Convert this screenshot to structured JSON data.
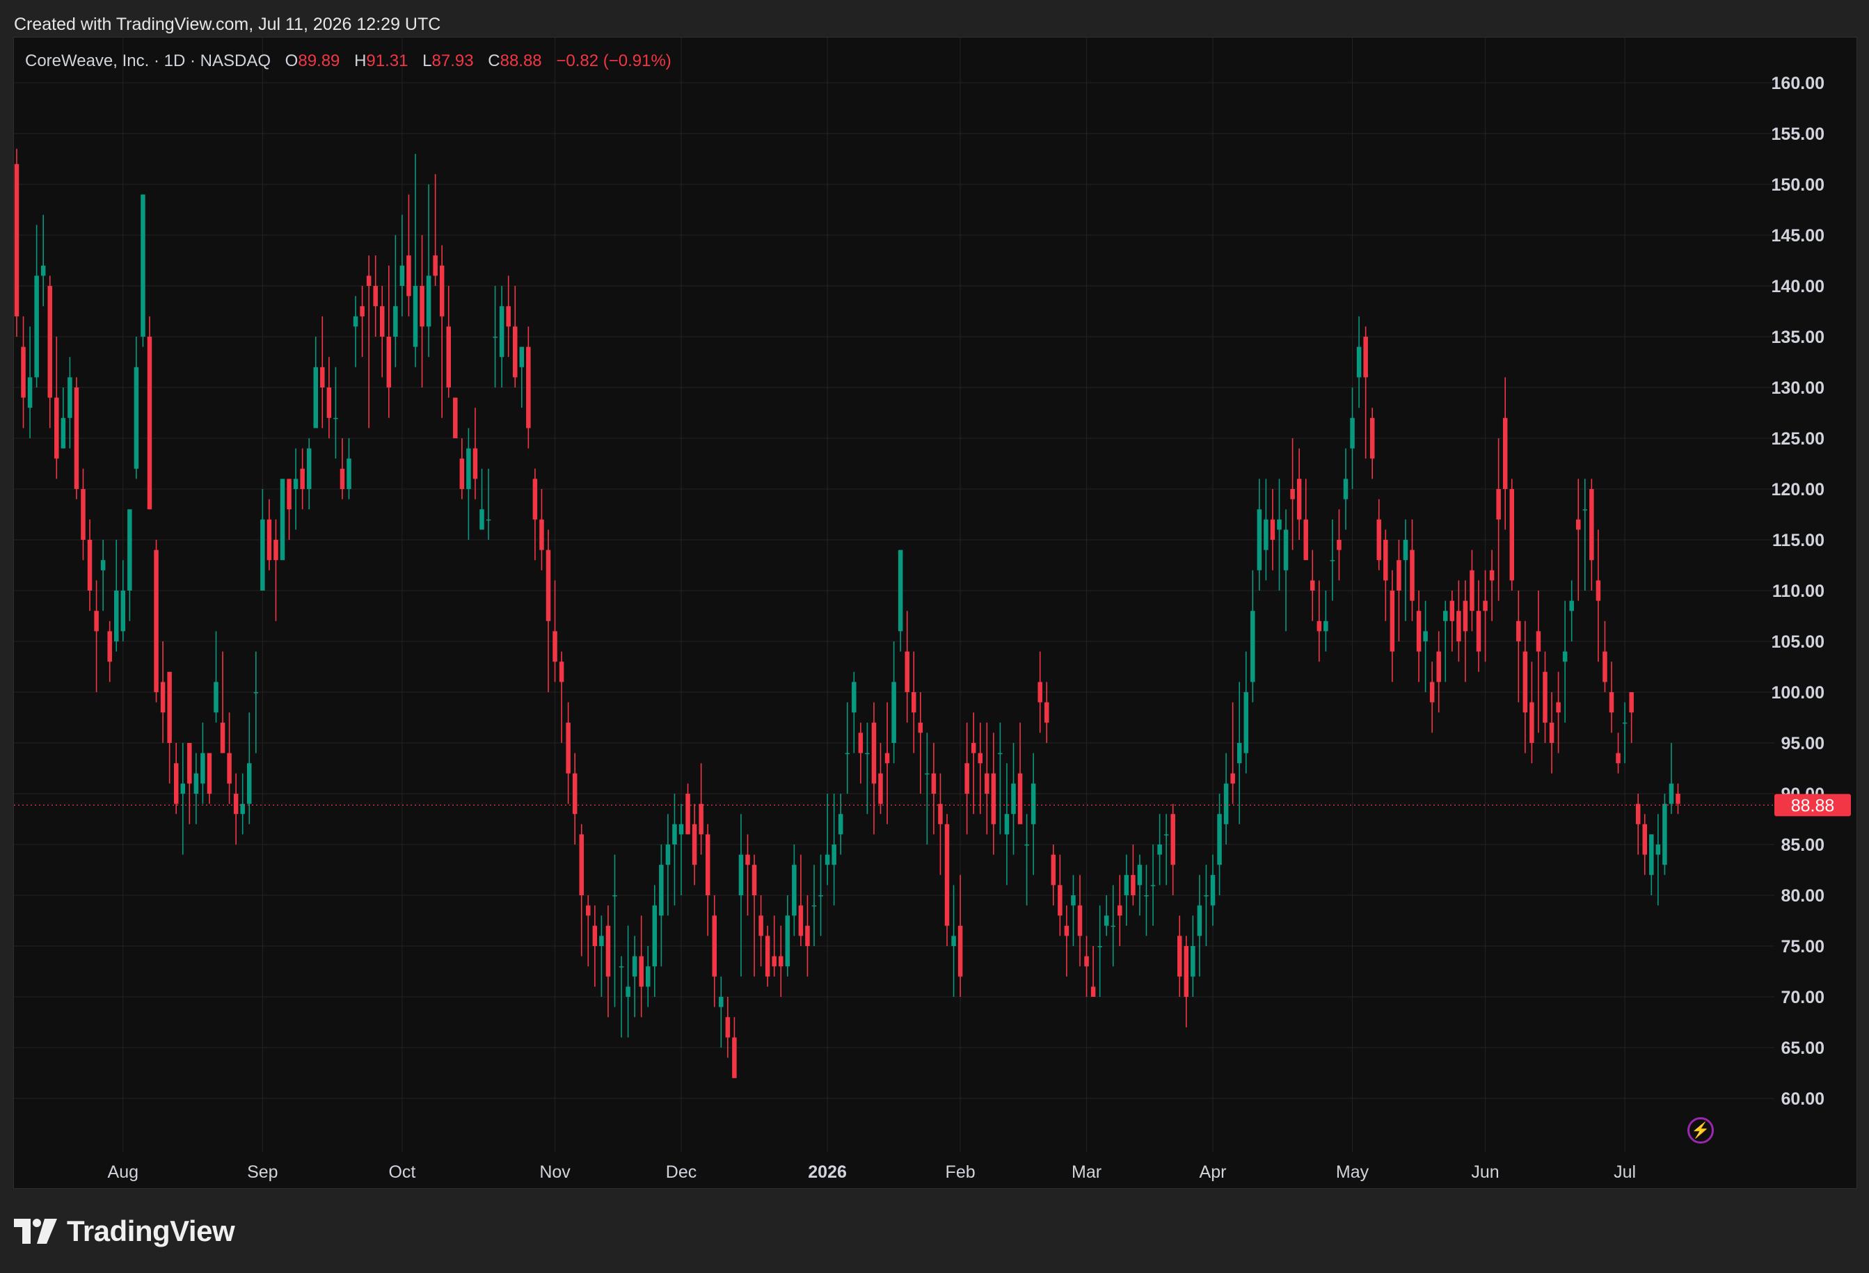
{
  "header": {
    "created_text": "Created with TradingView.com, Jul 11, 2026 12:29 UTC"
  },
  "legend": {
    "symbol_text": "CoreWeave, Inc. · 1D · NASDAQ",
    "open_label": "O",
    "open_value": "89.89",
    "high_label": "H",
    "high_value": "91.31",
    "low_label": "L",
    "low_value": "87.93",
    "close_label": "C",
    "close_value": "88.88",
    "change_text": "−0.82 (−0.91%)"
  },
  "footer": {
    "brand": "TradingView"
  },
  "colors": {
    "up": "#089981",
    "down": "#f23645",
    "background": "#0f0f0f",
    "grid": "#232323",
    "axis_text": "#d1d4dc",
    "price_tag": "#f23645"
  },
  "chart_data": {
    "type": "candlestick",
    "title": "CoreWeave, Inc. · 1D · NASDAQ",
    "xlabel": "",
    "ylabel": "",
    "ylim": [
      55,
      162
    ],
    "y_ticks": [
      "60.00",
      "65.00",
      "70.00",
      "75.00",
      "80.00",
      "85.00",
      "90.00",
      "95.00",
      "100.00",
      "105.00",
      "110.00",
      "115.00",
      "120.00",
      "125.00",
      "130.00",
      "135.00",
      "140.00",
      "145.00",
      "150.00",
      "155.00",
      "160.00"
    ],
    "x_ticks": [
      {
        "label": "Aug",
        "bar": 16
      },
      {
        "label": "Sep",
        "bar": 37
      },
      {
        "label": "Oct",
        "bar": 58
      },
      {
        "label": "Nov",
        "bar": 81
      },
      {
        "label": "Dec",
        "bar": 100
      },
      {
        "label": "2026",
        "bar": 122,
        "bold": true
      },
      {
        "label": "Feb",
        "bar": 142
      },
      {
        "label": "Mar",
        "bar": 161
      },
      {
        "label": "Apr",
        "bar": 180
      },
      {
        "label": "May",
        "bar": 201
      },
      {
        "label": "Jun",
        "bar": 221
      },
      {
        "label": "Jul",
        "bar": 242
      }
    ],
    "last_price": "88.88",
    "grid": true,
    "bars": [
      [
        152,
        153.5,
        135,
        137
      ],
      [
        134,
        137,
        126,
        129
      ],
      [
        128,
        136,
        125,
        131
      ],
      [
        131,
        146,
        130,
        141
      ],
      [
        141,
        147,
        138,
        142
      ],
      [
        140,
        141,
        126,
        129
      ],
      [
        129,
        135,
        121,
        123
      ],
      [
        124,
        130,
        124,
        127
      ],
      [
        127,
        133,
        124,
        131
      ],
      [
        130,
        131,
        119,
        120
      ],
      [
        120,
        122,
        113,
        115
      ],
      [
        115,
        117,
        108,
        110
      ],
      [
        108,
        111,
        100,
        106
      ],
      [
        112,
        115,
        108,
        113
      ],
      [
        106,
        107,
        101,
        103
      ],
      [
        105,
        115,
        104,
        110
      ],
      [
        106,
        113,
        105,
        110
      ],
      [
        110,
        118,
        107,
        118
      ],
      [
        122,
        135,
        121,
        132
      ],
      [
        135,
        149,
        134,
        149
      ],
      [
        135,
        137,
        118,
        118
      ],
      [
        114,
        115,
        99,
        100
      ],
      [
        101,
        105,
        95,
        98
      ],
      [
        102,
        102,
        91,
        95
      ],
      [
        93,
        95,
        88,
        89
      ],
      [
        90,
        95,
        84,
        91
      ],
      [
        95,
        95,
        87,
        91
      ],
      [
        90,
        94,
        87,
        92
      ],
      [
        91,
        97,
        89,
        94
      ],
      [
        94,
        94,
        89,
        90
      ],
      [
        98,
        106,
        97,
        101
      ],
      [
        97,
        104,
        96,
        94
      ],
      [
        94,
        98,
        89,
        91
      ],
      [
        90,
        92,
        85,
        88
      ],
      [
        88,
        92,
        86,
        89
      ],
      [
        89,
        98,
        87,
        93
      ],
      [
        100,
        104,
        94,
        100
      ],
      [
        110,
        120,
        110,
        117
      ],
      [
        117,
        119,
        112,
        113
      ],
      [
        115,
        117,
        107,
        113
      ],
      [
        113,
        121,
        116,
        121
      ],
      [
        121,
        121,
        115,
        118
      ],
      [
        120,
        124,
        116,
        121
      ],
      [
        122,
        124,
        118,
        120
      ],
      [
        120,
        125,
        118,
        124
      ],
      [
        126,
        135,
        126,
        132
      ],
      [
        132,
        137,
        126,
        130
      ],
      [
        130,
        133,
        125,
        127
      ],
      [
        127,
        132,
        123,
        127
      ],
      [
        122,
        125,
        119,
        120
      ],
      [
        120,
        125,
        119,
        123
      ],
      [
        136,
        139,
        132,
        137
      ],
      [
        138,
        140,
        133,
        137
      ],
      [
        141,
        143,
        126,
        140
      ],
      [
        140,
        143,
        135,
        138
      ],
      [
        138,
        140,
        131,
        135
      ],
      [
        135,
        142,
        127,
        130
      ],
      [
        135,
        145,
        132,
        138
      ],
      [
        140,
        147,
        137,
        142
      ],
      [
        143,
        149,
        137,
        139
      ],
      [
        134,
        153,
        132,
        140
      ],
      [
        140,
        145,
        130,
        136
      ],
      [
        136,
        150,
        133,
        141
      ],
      [
        143,
        151,
        140,
        141
      ],
      [
        142,
        144,
        127,
        137
      ],
      [
        136,
        140,
        129,
        130
      ],
      [
        129,
        127,
        126,
        125
      ],
      [
        123,
        125,
        119,
        120
      ],
      [
        120,
        126,
        115,
        124
      ],
      [
        124,
        128,
        119,
        121
      ],
      [
        116,
        122,
        116,
        118
      ],
      [
        117,
        122,
        115,
        117
      ],
      [
        135,
        140,
        130,
        135
      ],
      [
        133,
        140,
        130,
        138
      ],
      [
        138,
        141,
        133,
        136
      ],
      [
        136,
        140,
        130,
        131
      ],
      [
        132,
        134,
        128,
        134
      ],
      [
        134,
        136,
        124,
        126
      ],
      [
        121,
        122,
        113,
        117
      ],
      [
        117,
        120,
        112,
        114
      ],
      [
        114,
        116,
        100,
        107
      ],
      [
        106,
        111,
        101,
        103
      ],
      [
        103,
        104,
        95,
        101
      ],
      [
        97,
        99,
        89,
        92
      ],
      [
        92,
        94,
        85,
        88
      ],
      [
        86,
        87,
        74,
        80
      ],
      [
        79,
        80,
        73,
        78
      ],
      [
        77,
        79,
        71,
        75
      ],
      [
        75,
        78,
        70,
        76
      ],
      [
        77,
        79,
        68,
        72
      ],
      [
        80,
        84,
        69,
        80
      ],
      [
        73,
        74,
        66,
        73
      ],
      [
        70,
        77,
        66,
        71
      ],
      [
        72,
        76,
        68,
        74
      ],
      [
        74,
        78,
        68,
        71
      ],
      [
        71,
        75,
        69,
        73
      ],
      [
        73,
        81,
        70,
        79
      ],
      [
        78,
        85,
        73,
        83
      ],
      [
        83,
        88,
        78,
        85
      ],
      [
        85,
        90,
        79,
        87
      ],
      [
        86,
        89,
        80,
        87
      ],
      [
        90,
        91,
        86,
        86
      ],
      [
        87,
        89,
        81,
        83
      ],
      [
        89,
        93,
        84,
        86
      ],
      [
        86,
        87,
        76,
        80
      ],
      [
        78,
        80,
        69,
        72
      ],
      [
        69,
        72,
        65,
        70
      ],
      [
        68,
        70,
        64,
        66
      ],
      [
        66,
        68,
        62,
        62
      ],
      [
        80,
        88,
        72,
        84
      ],
      [
        84,
        86,
        78,
        83
      ],
      [
        83,
        84,
        72,
        80
      ],
      [
        78,
        80,
        73,
        76
      ],
      [
        76,
        77,
        71,
        72
      ],
      [
        74,
        78,
        72,
        73
      ],
      [
        74,
        77,
        70,
        73
      ],
      [
        73,
        80,
        72,
        78
      ],
      [
        78,
        85,
        76,
        83
      ],
      [
        79,
        84,
        75,
        76
      ],
      [
        77,
        80,
        72,
        75
      ],
      [
        79,
        83,
        75,
        79
      ],
      [
        80,
        84,
        76,
        80
      ],
      [
        83,
        90,
        81,
        84
      ],
      [
        83,
        90,
        79,
        85
      ],
      [
        86,
        90,
        84,
        88
      ],
      [
        94,
        99,
        90,
        94
      ],
      [
        98,
        102,
        94,
        101
      ],
      [
        96,
        97,
        91,
        94
      ],
      [
        94,
        97,
        88,
        94
      ],
      [
        97,
        99,
        86,
        91
      ],
      [
        92,
        95,
        88,
        89
      ],
      [
        94,
        99,
        87,
        93
      ],
      [
        95,
        105,
        93,
        101
      ],
      [
        106,
        114,
        104,
        114
      ],
      [
        104,
        108,
        97,
        100
      ],
      [
        100,
        104,
        94,
        98
      ],
      [
        97,
        100,
        90,
        96
      ],
      [
        92,
        96,
        85,
        92
      ],
      [
        92,
        95,
        86,
        90
      ],
      [
        89,
        92,
        82,
        87
      ],
      [
        87,
        88,
        75,
        77
      ],
      [
        75,
        81,
        70,
        76
      ],
      [
        77,
        82,
        70,
        72
      ],
      [
        93,
        97,
        86,
        90
      ],
      [
        95,
        98,
        88,
        94
      ],
      [
        94,
        97,
        88,
        93
      ],
      [
        92,
        97,
        86,
        90
      ],
      [
        92,
        96,
        84,
        87
      ],
      [
        94,
        97,
        86,
        94
      ],
      [
        86,
        93,
        81,
        88
      ],
      [
        88,
        95,
        84,
        91
      ],
      [
        92,
        97,
        87,
        87
      ],
      [
        85,
        88,
        79,
        85
      ],
      [
        87,
        94,
        82,
        91
      ],
      [
        101,
        104,
        96,
        99
      ],
      [
        99,
        101,
        95,
        97
      ],
      [
        84,
        85,
        79,
        81
      ],
      [
        81,
        84,
        76,
        78
      ],
      [
        77,
        79,
        72,
        76
      ],
      [
        79,
        82,
        75,
        80
      ],
      [
        79,
        82,
        73,
        76
      ],
      [
        74,
        76,
        70,
        73
      ],
      [
        71,
        75,
        70,
        70
      ],
      [
        75,
        79,
        70,
        75
      ],
      [
        77,
        80,
        76,
        78
      ],
      [
        77,
        81,
        73,
        77
      ],
      [
        79,
        82,
        75,
        78
      ],
      [
        80,
        84,
        77,
        82
      ],
      [
        82,
        85,
        79,
        80
      ],
      [
        81,
        84,
        78,
        83
      ],
      [
        80,
        83,
        76,
        80
      ],
      [
        81,
        85,
        77,
        81
      ],
      [
        84,
        88,
        81,
        85
      ],
      [
        86,
        88,
        81,
        86
      ],
      [
        88,
        89,
        80,
        83
      ],
      [
        76,
        78,
        70,
        72
      ],
      [
        75,
        76,
        67,
        70
      ],
      [
        72,
        78,
        70,
        75
      ],
      [
        76,
        82,
        72,
        79
      ],
      [
        80,
        83,
        75,
        80
      ],
      [
        79,
        84,
        77,
        82
      ],
      [
        83,
        90,
        80,
        88
      ],
      [
        87,
        94,
        85,
        91
      ],
      [
        92,
        99,
        89,
        91
      ],
      [
        93,
        101,
        87,
        95
      ],
      [
        94,
        104,
        92,
        100
      ],
      [
        101,
        112,
        99,
        108
      ],
      [
        112,
        121,
        110,
        118
      ],
      [
        114,
        121,
        111,
        117
      ],
      [
        117,
        120,
        112,
        115
      ],
      [
        116,
        121,
        110,
        117
      ],
      [
        112,
        118,
        106,
        116
      ],
      [
        120,
        125,
        114,
        119
      ],
      [
        121,
        124,
        115,
        117
      ],
      [
        117,
        121,
        113,
        113
      ],
      [
        111,
        114,
        107,
        110
      ],
      [
        107,
        111,
        103,
        106
      ],
      [
        106,
        110,
        104,
        107
      ],
      [
        113,
        117,
        109,
        113
      ],
      [
        115,
        118,
        111,
        114
      ],
      [
        119,
        124,
        116,
        121
      ],
      [
        124,
        130,
        120,
        127
      ],
      [
        131,
        137,
        128,
        134
      ],
      [
        135,
        136,
        123,
        131
      ],
      [
        127,
        128,
        121,
        123
      ],
      [
        117,
        119,
        112,
        113
      ],
      [
        115,
        116,
        107,
        111
      ],
      [
        110,
        112,
        101,
        104
      ],
      [
        113,
        115,
        105,
        110
      ],
      [
        113,
        117,
        107,
        115
      ],
      [
        114,
        117,
        107,
        109
      ],
      [
        108,
        110,
        101,
        104
      ],
      [
        105,
        109,
        100,
        106
      ],
      [
        101,
        103,
        96,
        99
      ],
      [
        104,
        106,
        98,
        101
      ],
      [
        107,
        109,
        101,
        108
      ],
      [
        109,
        110,
        104,
        107
      ],
      [
        108,
        111,
        103,
        105
      ],
      [
        109,
        111,
        101,
        106
      ],
      [
        112,
        114,
        106,
        108
      ],
      [
        108,
        111,
        102,
        104
      ],
      [
        109,
        112,
        103,
        108
      ],
      [
        112,
        114,
        107,
        111
      ],
      [
        120,
        125,
        109,
        117
      ],
      [
        127,
        131,
        116,
        120
      ],
      [
        120,
        121,
        110,
        111
      ],
      [
        107,
        110,
        99,
        105
      ],
      [
        104,
        107,
        94,
        98
      ],
      [
        99,
        103,
        93,
        95
      ],
      [
        106,
        110,
        96,
        104
      ],
      [
        102,
        104,
        95,
        97
      ],
      [
        97,
        100,
        92,
        95
      ],
      [
        99,
        102,
        94,
        98
      ],
      [
        103,
        109,
        97,
        104
      ],
      [
        108,
        111,
        105,
        109
      ],
      [
        117,
        121,
        109,
        116
      ],
      [
        118,
        121,
        110,
        118
      ],
      [
        120,
        121,
        110,
        113
      ],
      [
        111,
        116,
        103,
        109
      ],
      [
        104,
        107,
        100,
        101
      ],
      [
        100,
        103,
        96,
        98
      ],
      [
        94,
        96,
        92,
        93
      ],
      [
        97,
        99,
        93,
        97
      ],
      [
        100,
        100,
        95,
        98
      ],
      [
        89,
        90,
        84,
        87
      ],
      [
        87,
        88,
        82,
        84
      ],
      [
        82,
        86,
        80,
        86
      ],
      [
        84,
        88,
        79,
        85
      ],
      [
        83,
        90,
        82,
        89
      ],
      [
        89,
        95,
        88,
        91
      ],
      [
        90,
        91,
        88,
        89
      ]
    ]
  }
}
